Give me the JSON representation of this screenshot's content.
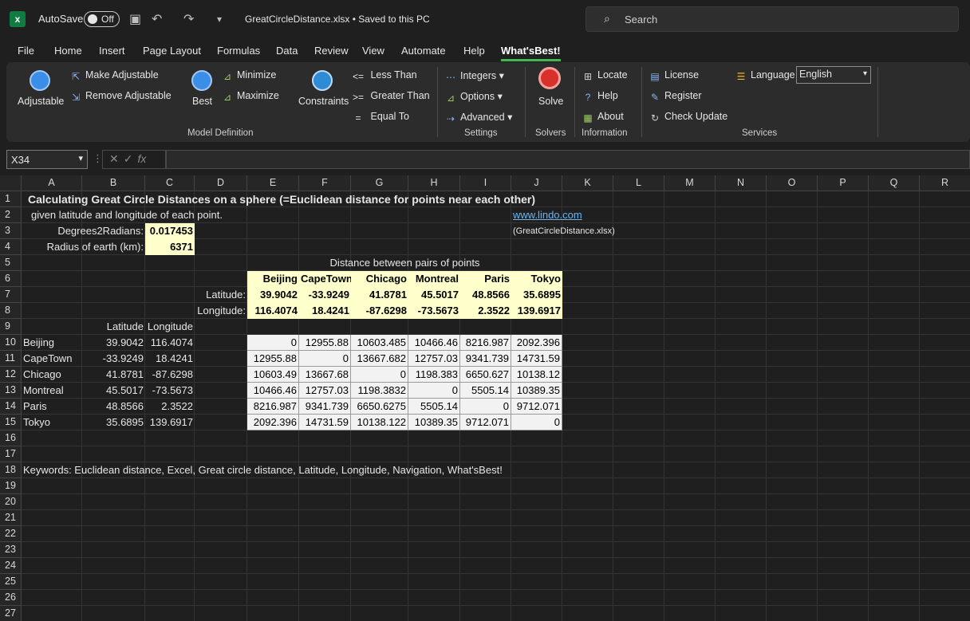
{
  "titlebar": {
    "autosave_label": "AutoSave",
    "autosave_state": "Off",
    "doc_title": "GreatCircleDistance.xlsx • Saved to this PC",
    "search_placeholder": "Search"
  },
  "menu": [
    "File",
    "Home",
    "Insert",
    "Page Layout",
    "Formulas",
    "Data",
    "Review",
    "View",
    "Automate",
    "Help",
    "What'sBest!"
  ],
  "ribbon": {
    "adjustable": "Adjustable",
    "make_adjustable": "Make Adjustable",
    "remove_adjustable": "Remove Adjustable",
    "best": "Best",
    "minimize": "Minimize",
    "maximize": "Maximize",
    "constraints": "Constraints",
    "less_than": "Less Than",
    "greater_than": "Greater Than",
    "equal_to": "Equal To",
    "model_definition": "Model Definition",
    "integers": "Integers",
    "options": "Options",
    "advanced": "Advanced",
    "settings": "Settings",
    "solve": "Solve",
    "solvers": "Solvers",
    "locate": "Locate",
    "help": "Help",
    "about": "About",
    "information": "Information",
    "license": "License",
    "register": "Register",
    "check_update": "Check Update",
    "language": "Language",
    "language_value": "English",
    "services": "Services"
  },
  "formula_bar": {
    "name_box": "X34",
    "fx": "fx"
  },
  "columns": [
    "A",
    "B",
    "C",
    "D",
    "E",
    "F",
    "G",
    "H",
    "I",
    "J",
    "K",
    "L",
    "M",
    "N",
    "O",
    "P",
    "Q",
    "R"
  ],
  "rows": [
    "1",
    "2",
    "3",
    "4",
    "5",
    "6",
    "7",
    "8",
    "9",
    "10",
    "11",
    "12",
    "13",
    "14",
    "15",
    "16",
    "17",
    "18",
    "19",
    "20",
    "21",
    "22",
    "23",
    "24",
    "25",
    "26",
    "27"
  ],
  "sheet": {
    "title": "Calculating Great Circle Distances on a sphere (=Euclidean distance for points near each other)",
    "subtitle": "given latitude and longitude of each point.",
    "link": "www.lindo.com",
    "filename": "(GreatCircleDistance.xlsx)",
    "deg2rad_label": "Degrees2Radians:",
    "deg2rad_value": "0.017453",
    "radius_label": "Radius of earth (km):",
    "radius_value": "6371",
    "dist_header": "Distance between pairs of points",
    "latitude_label": "Latitude:",
    "longitude_label": "Longitude:",
    "lat_col": "Latitude",
    "lon_col": "Longitude",
    "cities": [
      "Beijing",
      "CapeTown",
      "Chicago",
      "Montreal",
      "Paris",
      "Tokyo"
    ],
    "lat_row": [
      "39.9042",
      "-33.9249",
      "41.8781",
      "45.5017",
      "48.8566",
      "35.6895"
    ],
    "lon_row": [
      "116.4074",
      "18.4241",
      "-87.6298",
      "-73.5673",
      "2.3522",
      "139.6917"
    ],
    "table": [
      [
        "Beijing",
        "39.9042",
        "116.4074"
      ],
      [
        "CapeTown",
        "-33.9249",
        "18.4241"
      ],
      [
        "Chicago",
        "41.8781",
        "-87.6298"
      ],
      [
        "Montreal",
        "45.5017",
        "-73.5673"
      ],
      [
        "Paris",
        "48.8566",
        "2.3522"
      ],
      [
        "Tokyo",
        "35.6895",
        "139.6917"
      ]
    ],
    "matrix": [
      [
        "0",
        "12955.88",
        "10603.485",
        "10466.46",
        "8216.987",
        "2092.396"
      ],
      [
        "12955.88",
        "0",
        "13667.682",
        "12757.03",
        "9341.739",
        "14731.59"
      ],
      [
        "10603.49",
        "13667.68",
        "0",
        "1198.383",
        "6650.627",
        "10138.12"
      ],
      [
        "10466.46",
        "12757.03",
        "1198.3832",
        "0",
        "5505.14",
        "10389.35"
      ],
      [
        "8216.987",
        "9341.739",
        "6650.6275",
        "5505.14",
        "0",
        "9712.071"
      ],
      [
        "2092.396",
        "14731.59",
        "10138.122",
        "10389.35",
        "9712.071",
        "0"
      ]
    ],
    "keywords": "Keywords: Euclidean distance, Excel, Great circle distance, Latitude, Longitude, Navigation, What'sBest!"
  }
}
